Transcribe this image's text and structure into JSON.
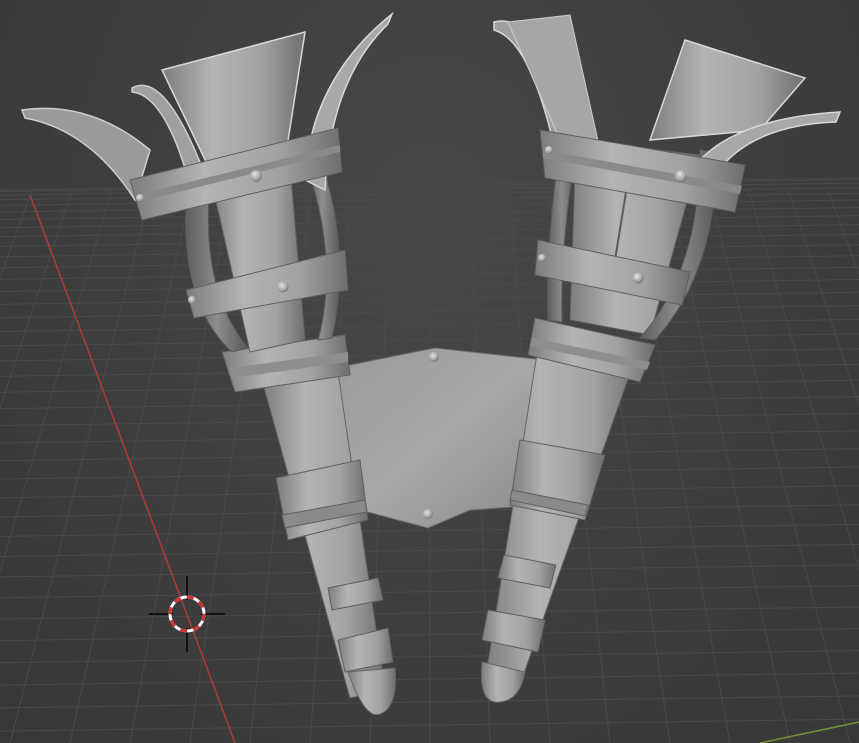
{
  "viewport": {
    "name": "3D Viewport",
    "background_color": "#3d3d3d",
    "grid_color": "#4a4a4a",
    "x_axis_color": "#a83a3a",
    "y_axis_color": "#6d8f3a"
  },
  "scene": {
    "objects": [
      {
        "name": "torch-left"
      },
      {
        "name": "torch-right"
      },
      {
        "name": "wall-plate"
      }
    ],
    "cursor": {
      "icon": "3d-cursor-icon"
    },
    "shading": {
      "mode": "solid",
      "mesh_color": "#a4a4a4"
    }
  }
}
